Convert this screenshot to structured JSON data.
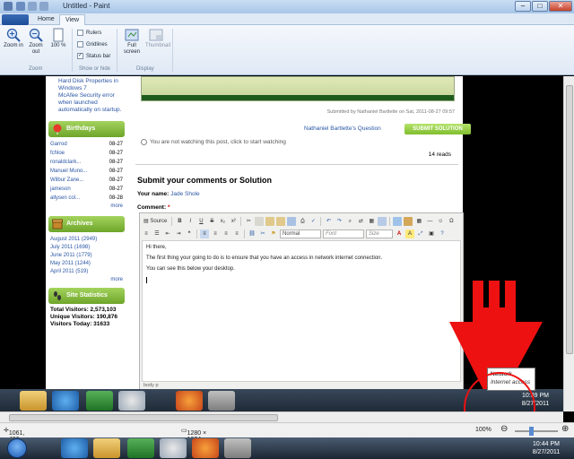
{
  "window": {
    "title": "Untitled - Paint",
    "controls": {
      "minimize": "–",
      "maximize": "□",
      "close": "✕"
    }
  },
  "ribbon": {
    "tabs": [
      {
        "label": "Home"
      },
      {
        "label": "View"
      }
    ],
    "zoom_in": "Zoom in",
    "zoom_out": "Zoom out",
    "hundred": "100 %",
    "group_zoom": "Zoom",
    "rulers": "Rulers",
    "gridlines": "Gridlines",
    "status_bar": "Status bar",
    "group_showhide": "Show or hide",
    "full_screen": "Full screen",
    "thumbnail": "Thumbnail",
    "group_display": "Display"
  },
  "sidebar": {
    "links": [
      "Hard Disk Properties in Windows 7",
      "McAfee Security error when launched automatically on startup."
    ],
    "birthdays_title": "Birthdays",
    "birthdays": [
      {
        "name": "Garrod",
        "date": "08-27"
      },
      {
        "name": "fchloe",
        "date": "08-27"
      },
      {
        "name": "ronaldclark...",
        "date": "08-27"
      },
      {
        "name": "Manuel Muno...",
        "date": "08-27"
      },
      {
        "name": "Wilbur Zane...",
        "date": "08-27"
      },
      {
        "name": "jameson",
        "date": "08-27"
      },
      {
        "name": "allysen col...",
        "date": "08-28"
      }
    ],
    "more": "more",
    "archives_title": "Archives",
    "archives": [
      "August 2011 (2949)",
      "July 2011 (1698)",
      "June 2011 (1779)",
      "May 2011 (1244)",
      "April 2011 (519)"
    ],
    "stats_title": "Site Statistics",
    "stats": [
      "Total Visitors: 2,573,103",
      "Unique Visitors: 190,876",
      "Visitors Today: 31633"
    ]
  },
  "post": {
    "submitted": "Submitted by Nathaniel Bartlette on Sat, 2011-08-27 09:57",
    "author_link": "Nathaniel Bartlette's Question",
    "submit_solution": "SUBMIT SOLUTION",
    "watch_text": "You are not watching this post, click to start watching",
    "reads": "14 reads"
  },
  "comments": {
    "title": "Submit your comments or Solution",
    "name_label": "Your name:",
    "name_value": "Jade Shole",
    "comment_label": "Comment:",
    "required": "*"
  },
  "editor": {
    "source": "Source",
    "format": "Normal",
    "font": "Font",
    "size": "Size",
    "lines": [
      "Hi there,",
      "The first thing your going to do is to ensure that you have an access in network  internet connection.",
      "You can see this below your desktop."
    ],
    "path": "body  p"
  },
  "tooltip": {
    "title": "Network",
    "subtitle": "Internet access"
  },
  "inner_taskbar": {
    "time": "10:39 PM",
    "date": "8/27/2011"
  },
  "statusbar": {
    "cursor": "1061, 486px",
    "size": "1280 × 1024px",
    "zoom": "100%"
  },
  "taskbar": {
    "time": "10:44 PM",
    "date": "8/27/2011"
  }
}
